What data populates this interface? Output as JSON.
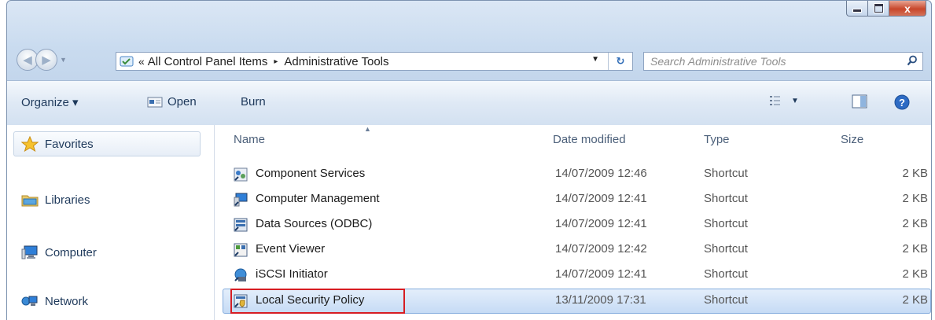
{
  "window": {
    "min_label": "",
    "max_label": "",
    "close_label": "x"
  },
  "address": {
    "chevron": "«",
    "crumbs": [
      "All Control Panel Items",
      "Administrative Tools"
    ],
    "separator": "▸"
  },
  "search": {
    "placeholder": "Search Administrative Tools"
  },
  "toolbar": {
    "organize": "Organize ▾",
    "open": "Open",
    "burn": "Burn"
  },
  "navpane": {
    "items": [
      {
        "label": "Favorites",
        "icon": "star-icon"
      },
      {
        "label": "Libraries",
        "icon": "libraries-icon"
      },
      {
        "label": "Computer",
        "icon": "computer-icon"
      },
      {
        "label": "Network",
        "icon": "network-icon"
      }
    ]
  },
  "list": {
    "columns": [
      "Name",
      "Date modified",
      "Type",
      "Size"
    ],
    "rows": [
      {
        "name": "Component Services",
        "date": "14/07/2009 12:46",
        "type": "Shortcut",
        "size": "2 KB"
      },
      {
        "name": "Computer Management",
        "date": "14/07/2009 12:41",
        "type": "Shortcut",
        "size": "2 KB"
      },
      {
        "name": "Data Sources (ODBC)",
        "date": "14/07/2009 12:41",
        "type": "Shortcut",
        "size": "2 KB"
      },
      {
        "name": "Event Viewer",
        "date": "14/07/2009 12:42",
        "type": "Shortcut",
        "size": "2 KB"
      },
      {
        "name": "iSCSI Initiator",
        "date": "14/07/2009 12:41",
        "type": "Shortcut",
        "size": "2 KB"
      },
      {
        "name": "Local Security Policy",
        "date": "13/11/2009 17:31",
        "type": "Shortcut",
        "size": "2 KB"
      }
    ]
  },
  "colors": {
    "selection": "#c6dbf5",
    "highlight_border": "#d61d23",
    "close_button": "#c8462b"
  }
}
